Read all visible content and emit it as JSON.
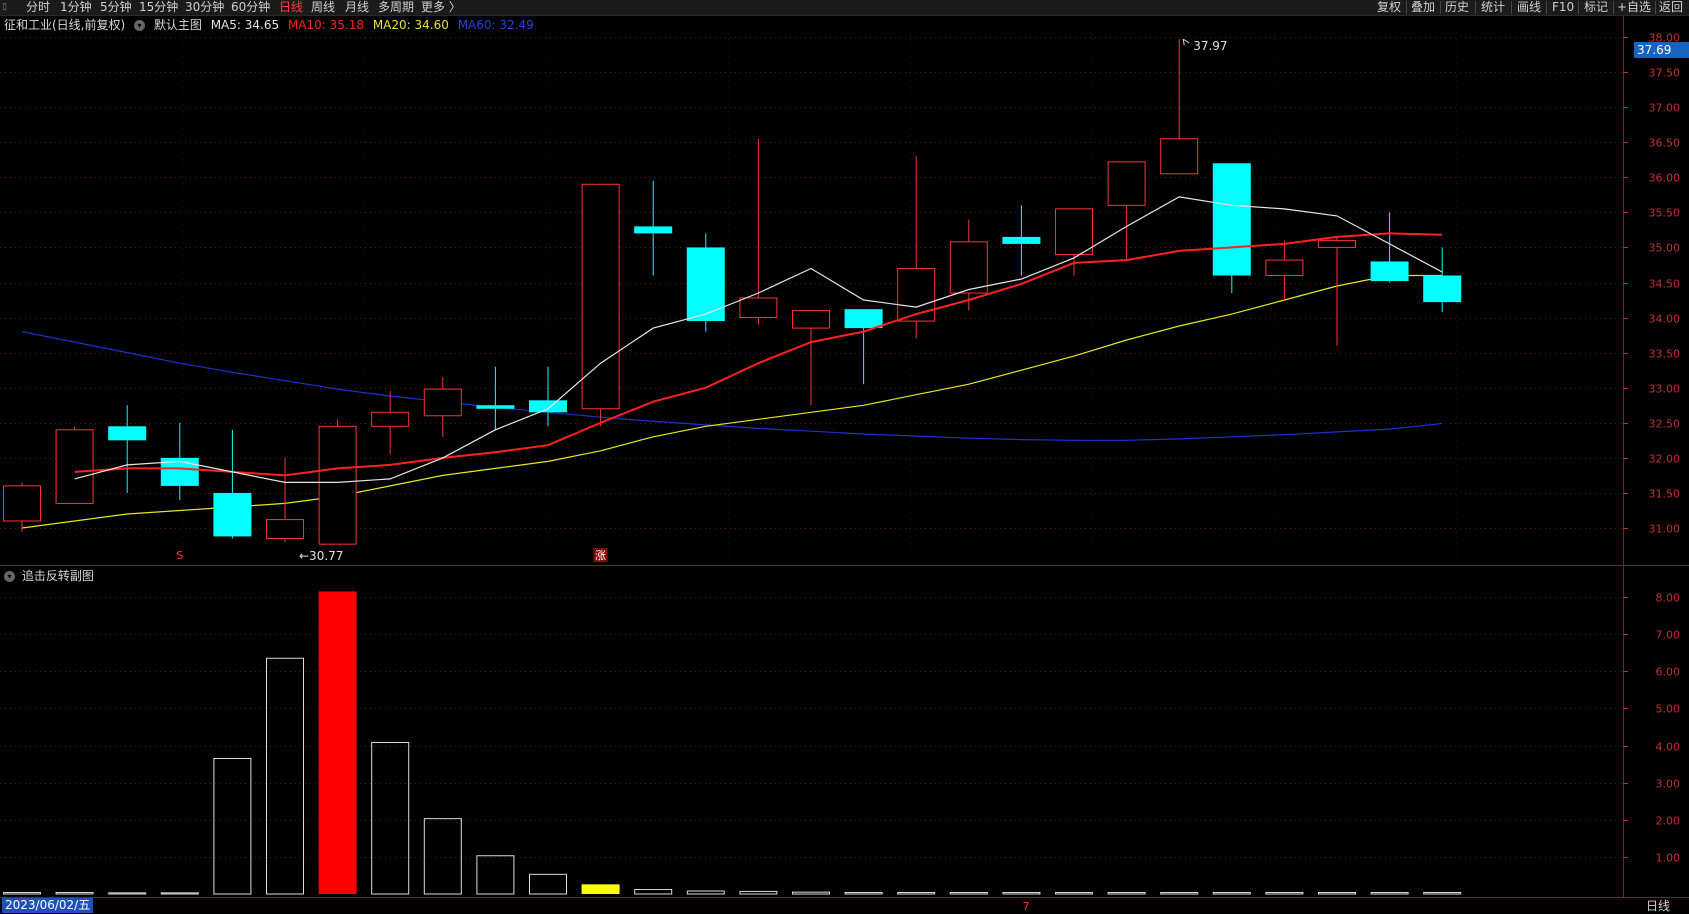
{
  "toolbar": {
    "periods": [
      "分时",
      "1分钟",
      "5分钟",
      "15分钟",
      "30分钟",
      "60分钟",
      "日线",
      "周线",
      "月线",
      "多周期",
      "更多 〉"
    ],
    "active_period": "日线",
    "right_tools": [
      "复权",
      "叠加",
      "历史",
      "统计",
      "画线",
      "F10",
      "标记",
      "+自选",
      "返回"
    ]
  },
  "main_header": {
    "stock_title": "征和工业(日线,前复权)",
    "main_chart_label": "默认主图",
    "ma5": "MA5: 34.65",
    "ma10": "MA10: 35.18",
    "ma20": "MA20: 34.60",
    "ma60": "MA60: 32.49"
  },
  "sub_header": {
    "label": "追击反转副图"
  },
  "current_price": "37.69",
  "date_label": "2023/06/02/五",
  "period_label": "日线",
  "annotations": {
    "high_label": "37.97",
    "low_label": "30.77",
    "signal_s": "S",
    "signal_zhang": "涨",
    "signal_7": "7"
  },
  "colors": {
    "up": "#ff3232",
    "down": "#00ffff",
    "ma5": "#e6e6e6",
    "ma10": "#ff2020",
    "ma20": "#e6e61e",
    "ma60": "#2030d0",
    "axis": "#c03030",
    "grid": "#5a1010"
  },
  "main_axis": {
    "ticks": [
      "38.00",
      "37.50",
      "37.00",
      "36.50",
      "36.00",
      "35.50",
      "35.00",
      "34.50",
      "34.00",
      "33.50",
      "33.00",
      "32.50",
      "32.00",
      "31.50",
      "31.00"
    ],
    "ymin": 30.5,
    "ymax": 38.2
  },
  "sub_axis": {
    "ticks": [
      "8.00",
      "7.00",
      "6.00",
      "5.00",
      "4.00",
      "3.00",
      "2.00",
      "1.00"
    ],
    "ymin": 0,
    "ymax": 8.55
  },
  "chart_data": {
    "type": "candlestick",
    "candles": [
      {
        "o": 31.1,
        "c": 31.6,
        "h": 31.65,
        "l": 30.95
      },
      {
        "o": 31.35,
        "c": 32.4,
        "h": 32.45,
        "l": 31.35
      },
      {
        "o": 32.45,
        "c": 32.25,
        "h": 32.75,
        "l": 31.5
      },
      {
        "o": 32.0,
        "c": 31.6,
        "h": 32.5,
        "l": 31.4
      },
      {
        "o": 31.5,
        "c": 30.88,
        "h": 32.4,
        "l": 30.85
      },
      {
        "o": 30.85,
        "c": 31.12,
        "h": 32.0,
        "l": 30.8
      },
      {
        "o": 30.77,
        "c": 32.45,
        "h": 32.55,
        "l": 30.77
      },
      {
        "o": 32.45,
        "c": 32.65,
        "h": 32.95,
        "l": 32.05
      },
      {
        "o": 32.6,
        "c": 32.98,
        "h": 33.15,
        "l": 32.3
      },
      {
        "o": 32.75,
        "c": 32.7,
        "h": 33.3,
        "l": 32.4
      },
      {
        "o": 32.82,
        "c": 32.65,
        "h": 33.3,
        "l": 32.45
      },
      {
        "o": 32.7,
        "c": 35.9,
        "h": 35.9,
        "l": 32.45
      },
      {
        "o": 35.3,
        "c": 35.2,
        "h": 35.95,
        "l": 34.6
      },
      {
        "o": 35.0,
        "c": 33.95,
        "h": 35.2,
        "l": 33.8
      },
      {
        "o": 34.0,
        "c": 34.28,
        "h": 36.55,
        "l": 33.9
      },
      {
        "o": 33.85,
        "c": 34.1,
        "h": 34.1,
        "l": 32.75
      },
      {
        "o": 34.12,
        "c": 33.85,
        "h": 34.12,
        "l": 33.05
      },
      {
        "o": 33.95,
        "c": 34.7,
        "h": 36.3,
        "l": 33.7
      },
      {
        "o": 34.35,
        "c": 35.08,
        "h": 35.4,
        "l": 34.1
      },
      {
        "o": 35.15,
        "c": 35.05,
        "h": 35.6,
        "l": 34.6
      },
      {
        "o": 34.9,
        "c": 35.55,
        "h": 35.55,
        "l": 34.6
      },
      {
        "o": 35.6,
        "c": 36.22,
        "h": 36.22,
        "l": 34.8
      },
      {
        "o": 36.05,
        "c": 36.55,
        "h": 37.97,
        "l": 36.05
      },
      {
        "o": 36.2,
        "c": 34.6,
        "h": 36.2,
        "l": 34.35
      },
      {
        "o": 34.6,
        "c": 34.82,
        "h": 35.1,
        "l": 34.25
      },
      {
        "o": 35.0,
        "c": 35.1,
        "h": 35.15,
        "l": 33.6
      },
      {
        "o": 34.8,
        "c": 34.52,
        "h": 35.5,
        "l": 34.5
      },
      {
        "o": 34.6,
        "c": 34.22,
        "h": 35.0,
        "l": 34.08
      }
    ],
    "ma5": [
      null,
      31.7,
      31.9,
      31.95,
      31.8,
      31.65,
      31.65,
      31.7,
      32.0,
      32.4,
      32.7,
      33.35,
      33.85,
      34.05,
      34.35,
      34.7,
      34.25,
      34.15,
      34.4,
      34.55,
      34.85,
      35.3,
      35.72,
      35.6,
      35.55,
      35.45,
      35.05,
      34.65
    ],
    "ma10": [
      null,
      31.8,
      31.85,
      31.85,
      31.8,
      31.75,
      31.85,
      31.9,
      32.0,
      32.08,
      32.18,
      32.5,
      32.8,
      33.0,
      33.35,
      33.65,
      33.8,
      34.05,
      34.25,
      34.48,
      34.78,
      34.82,
      34.95,
      35.0,
      35.05,
      35.15,
      35.2,
      35.18
    ],
    "ma20": [
      31.0,
      31.1,
      31.2,
      31.25,
      31.3,
      31.35,
      31.45,
      31.6,
      31.75,
      31.85,
      31.95,
      32.1,
      32.3,
      32.45,
      32.55,
      32.65,
      32.75,
      32.9,
      33.05,
      33.25,
      33.45,
      33.68,
      33.88,
      34.05,
      34.25,
      34.45,
      34.6,
      34.6
    ],
    "ma60": [
      33.8,
      33.65,
      33.5,
      33.35,
      33.22,
      33.1,
      32.98,
      32.88,
      32.8,
      32.72,
      32.65,
      32.58,
      32.52,
      32.47,
      32.42,
      32.38,
      32.34,
      32.31,
      32.28,
      32.26,
      32.25,
      32.25,
      32.27,
      32.3,
      32.33,
      32.37,
      32.41,
      32.49
    ],
    "sub_values": [
      0.04,
      0.04,
      0.03,
      0.03,
      3.65,
      6.35,
      8.15,
      4.08,
      2.03,
      1.03,
      0.53,
      0.26,
      0.12,
      0.08,
      0.07,
      0.05,
      0.04,
      0.04,
      0.04,
      0.04,
      0.04,
      0.04,
      0.04,
      0.04,
      0.04,
      0.04,
      0.04,
      0.04
    ],
    "sub_colors": [
      "w",
      "w",
      "w",
      "w",
      "w",
      "w",
      "r",
      "w",
      "w",
      "w",
      "w",
      "y",
      "w",
      "w",
      "w",
      "w",
      "w",
      "w",
      "w",
      "w",
      "w",
      "w",
      "w",
      "w",
      "w",
      "w",
      "w",
      "w"
    ]
  }
}
